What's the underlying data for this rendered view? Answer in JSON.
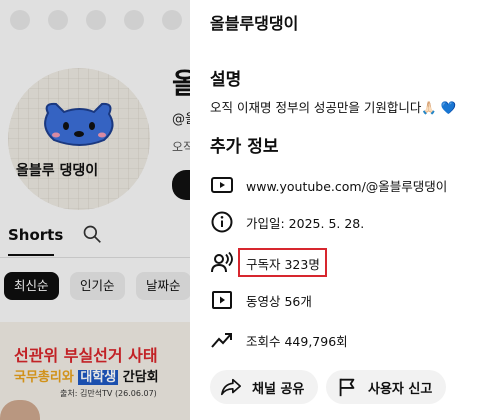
{
  "background": {
    "channel_title": "올",
    "channel_handle": "@올",
    "description_snippet": "오직",
    "avatar_text": "올블루 댕댕이",
    "tabs": {
      "shorts": "Shorts"
    },
    "chips": [
      "최신순",
      "인기순",
      "날짜순"
    ],
    "thumbnail": {
      "line1": "선관위 부실선거 사태",
      "line2_a": "국무총리와 ",
      "line2_b": "대학생",
      "line2_c": " 간담회",
      "line3": "출처: 김만석TV (26.06.07)"
    }
  },
  "about": {
    "channel_name": "올블루댕댕이",
    "description_heading": "설명",
    "description": "오직 이재명 정부의 성공만을 기원합니다🙏🏻 💙",
    "more_info_heading": "추가 정보",
    "url": "www.youtube.com/@올블루댕댕이",
    "joined": "가입일: 2025. 5. 28.",
    "subscribers": "구독자 323명",
    "videos": "동영상 56개",
    "views": "조회수 449,796회",
    "share_button": "채널 공유",
    "report_button": "사용자 신고"
  },
  "colors": {
    "highlight_box": "#d7262e",
    "chip_active": "#0f0f0f",
    "thumb_headline": "#d8262b",
    "thumb_highlight": "#1f59c2"
  },
  "icons": [
    "youtube-play-icon",
    "info-icon",
    "subscribers-icon",
    "video-icon",
    "trending-icon",
    "share-icon",
    "flag-icon",
    "search-icon"
  ]
}
